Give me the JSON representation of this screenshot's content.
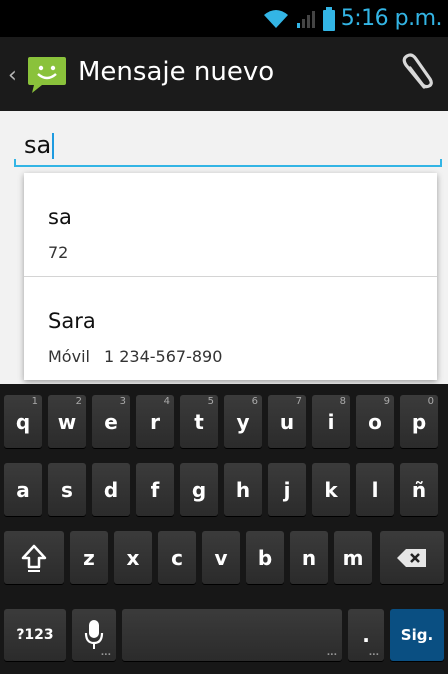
{
  "status_bar": {
    "time": "5:16 p.m.",
    "icons": [
      "wifi-icon",
      "signal-icon",
      "battery-icon"
    ]
  },
  "action_bar": {
    "title": "Mensaje nuevo",
    "back_icon": "chevron-left-icon",
    "app_icon": "messaging-app-icon",
    "attach_icon": "paperclip-icon"
  },
  "compose": {
    "to_value": "sa"
  },
  "suggestions": [
    {
      "name": "sa",
      "type": "",
      "number": "72"
    },
    {
      "name": "Sara",
      "type": "Móvil",
      "number": "1 234-567-890"
    }
  ],
  "keyboard": {
    "row1": [
      {
        "k": "q",
        "h": "1"
      },
      {
        "k": "w",
        "h": "2"
      },
      {
        "k": "e",
        "h": "3"
      },
      {
        "k": "r",
        "h": "4"
      },
      {
        "k": "t",
        "h": "5"
      },
      {
        "k": "y",
        "h": "6"
      },
      {
        "k": "u",
        "h": "7"
      },
      {
        "k": "i",
        "h": "8"
      },
      {
        "k": "o",
        "h": "9"
      },
      {
        "k": "p",
        "h": "0"
      }
    ],
    "row2": [
      "a",
      "s",
      "d",
      "f",
      "g",
      "h",
      "j",
      "k",
      "l",
      "ñ"
    ],
    "row3": [
      "z",
      "x",
      "c",
      "v",
      "b",
      "n",
      "m"
    ],
    "shift_icon": "shift-arrow-icon",
    "backspace_icon": "backspace-icon",
    "mic_icon": "microphone-icon",
    "symbols_label": "?123",
    "period_label": ".",
    "enter_label": "Sig."
  },
  "colors": {
    "accent": "#33b5e5",
    "go_key": "#0a4f82",
    "background": "#f2f2f2"
  }
}
